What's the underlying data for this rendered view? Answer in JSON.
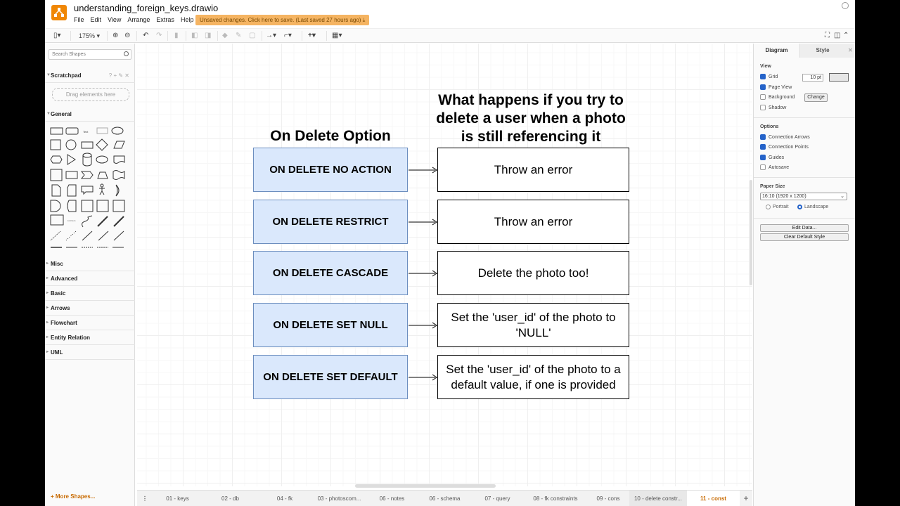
{
  "app": {
    "filename": "understanding_foreign_keys.drawio",
    "menu": [
      "File",
      "Edit",
      "View",
      "Arrange",
      "Extras",
      "Help"
    ],
    "unsaved_notice": "Unsaved changes. Click here to save. (Last saved 27 hours ago)",
    "accent": "#f08705"
  },
  "toolbar": {
    "zoom": "175%",
    "icons": [
      "format-panel-icon",
      "zoom-in-icon",
      "zoom-out-icon",
      "undo-icon",
      "redo-icon",
      "delete-icon",
      "to-front-icon",
      "to-back-icon",
      "fill-color-icon",
      "line-color-icon",
      "shadow-icon",
      "connection-icon",
      "waypoints-icon",
      "insert-icon",
      "table-icon",
      "fullscreen-icon",
      "format-toggle-icon",
      "collapse-icon"
    ]
  },
  "sidebar": {
    "search_placeholder": "Search Shapes",
    "scratchpad": {
      "label": "Scratchpad",
      "tools": "? + ✎ ✕",
      "drop_hint": "Drag elements here"
    },
    "general_label": "General",
    "sections": [
      "Misc",
      "Advanced",
      "Basic",
      "Arrows",
      "Flowchart",
      "Entity Relation",
      "UML"
    ],
    "more_shapes": "+ More Shapes..."
  },
  "diagram": {
    "left_title": "On Delete Option",
    "right_title": "What happens if you try to delete a user when a photo is still referencing it",
    "rows": [
      {
        "option": "ON DELETE NO ACTION",
        "result": "Throw an error"
      },
      {
        "option": "ON DELETE RESTRICT",
        "result": "Throw an error"
      },
      {
        "option": "ON DELETE CASCADE",
        "result": "Delete the photo too!"
      },
      {
        "option": "ON DELETE SET NULL",
        "result": "Set the 'user_id' of the photo to 'NULL'"
      },
      {
        "option": "ON DELETE SET DEFAULT",
        "result": "Set the 'user_id' of the photo to a default value, if one is provided"
      }
    ],
    "option_fill": "#dae8fc",
    "option_stroke": "#6c8ebf"
  },
  "format_panel": {
    "tabs": [
      "Diagram",
      "Style"
    ],
    "view_label": "View",
    "grid": {
      "label": "Grid",
      "checked": true,
      "size": "10 pt"
    },
    "page_view": {
      "label": "Page View",
      "checked": true
    },
    "background": {
      "label": "Background",
      "checked": false,
      "button": "Change"
    },
    "shadow": {
      "label": "Shadow",
      "checked": false
    },
    "options_label": "Options",
    "options": [
      {
        "label": "Connection Arrows",
        "checked": true
      },
      {
        "label": "Connection Points",
        "checked": true
      },
      {
        "label": "Guides",
        "checked": true
      },
      {
        "label": "Autosave",
        "checked": false
      }
    ],
    "paper_size_label": "Paper Size",
    "paper_size": "16:10 (1920 x 1200)",
    "orientation": {
      "portrait": "Portrait",
      "landscape": "Landscape",
      "selected": "Landscape"
    },
    "edit_data": "Edit Data...",
    "clear_style": "Clear Default Style"
  },
  "pages": [
    "01 - keys",
    "02 - db",
    "04 - fk",
    "03 - photoscom...",
    "06 - notes",
    "06 - schema",
    "07 - query",
    "08 - fk constraints",
    "09 - cons",
    "10 - delete constr...",
    "11 - const"
  ],
  "active_page": "11 - const"
}
